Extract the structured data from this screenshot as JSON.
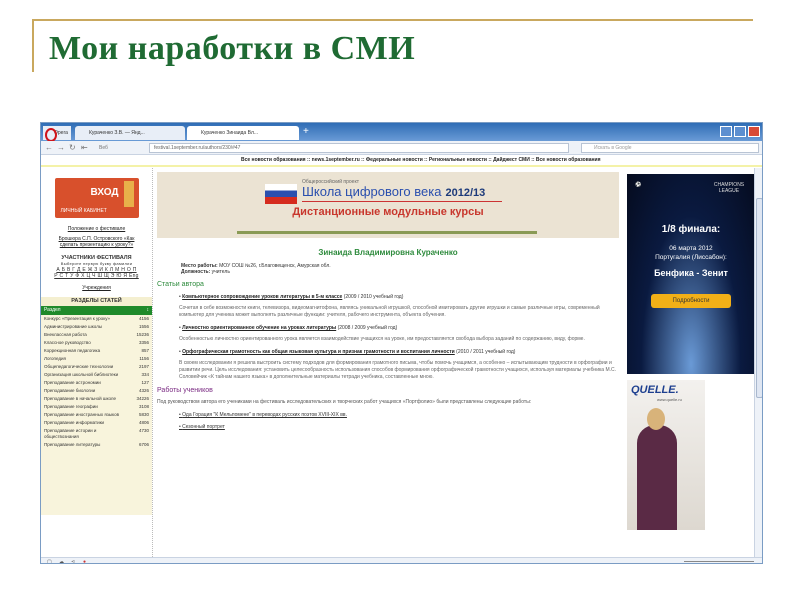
{
  "slide": {
    "title": "Мои наработки в СМИ"
  },
  "browser": {
    "tabs": [
      {
        "label": "Opera"
      },
      {
        "label": "Кураченко З.В. — Янд..."
      },
      {
        "label": "Кураченко Зинаида Вл..."
      }
    ],
    "url": "festival.1september.ru/authors/230/#47",
    "speed_dial_label": "Веб",
    "search_placeholder": "Искать в Google",
    "news_bar": "Все новости образования :: news.1september.ru :: Федеральные новости :: Региональные новости :: Дайджест СМИ :: Все новости образования"
  },
  "sidebar": {
    "login": {
      "title": "ВХОД",
      "subtitle": "ЛИЧНЫЙ КАБИНЕТ"
    },
    "links": [
      "Положение о фестивале",
      "Брошюра С.П. Островского «Как сделать презентацию к уроку?»"
    ],
    "participants_heading": "УЧАСТНИКИ ФЕСТИВАЛЯ",
    "participants_hint": "Выберите первую букву фамилии",
    "alphabet1": "А Б В Г Д Е Ж З И К Л М Н О П",
    "alphabet2": "Р С Т У Ф Х Ц Ч Ш Щ Э Ю Я Eng",
    "institutions": "Учреждения",
    "sections_heading": "РАЗДЕЛЫ СТАТЕЙ",
    "select_value": "Раздел",
    "categories": [
      {
        "name": "Конкурс «Презентация к уроку»",
        "count": "4156"
      },
      {
        "name": "Администрирование школы",
        "count": "1556"
      },
      {
        "name": "Внеклассная работа",
        "count": "15236"
      },
      {
        "name": "Классное руководство",
        "count": "3356"
      },
      {
        "name": "Коррекционная педагогика",
        "count": "857"
      },
      {
        "name": "Логопедия",
        "count": "1156"
      },
      {
        "name": "Общепедагогические технологии",
        "count": "2197"
      },
      {
        "name": "Организация школьной библиотеки",
        "count": "334"
      },
      {
        "name": "Преподавание астрономии",
        "count": "127"
      },
      {
        "name": "Преподавание биологии",
        "count": "4326"
      },
      {
        "name": "Преподавание в начальной школе",
        "count": "34226"
      },
      {
        "name": "Преподавание географии",
        "count": "3108"
      },
      {
        "name": "Преподавание иностранных языков",
        "count": "5830"
      },
      {
        "name": "Преподавание информатики",
        "count": "4806"
      },
      {
        "name": "Преподавание истории и обществознания",
        "count": "4730"
      },
      {
        "name": "Преподавание литературы",
        "count": "6706"
      }
    ]
  },
  "main": {
    "banner": {
      "project": "Общероссийский проект",
      "school": "Школа цифрового века",
      "year": "2012/13",
      "courses": "Дистанционные модульные курсы"
    },
    "author": "Зинаида Владимировна Кураченко",
    "workplace_label": "Место работы:",
    "workplace": "МОУ СОШ №26, г.Благовещенск, Амурская обл.",
    "position_label": "Должность:",
    "position": "учитель",
    "articles_heading": "Статьи автора",
    "articles": [
      {
        "title": "Компьютерное сопровождение уроков литературы в 5-м классе",
        "year": "(2009 / 2010 учебный год)",
        "desc": "Сочетая в себе возможности книги, телевизора, видеомагнитофона, являясь уникальной игрушкой, способной имитировать другие игрушки и самые различные игры, современный компьютер для ученика может выполнять различные функции: учителя, рабочего инструмента, объекта обучения."
      },
      {
        "title": "Личностно ориентированное обучение на уроках литературы",
        "year": "(2008 / 2009 учебный год)",
        "desc": "Особенностью личностно ориентированного урока является взаимодействие учащихся на уроке, им предоставляется свобода выбора заданий по содержанию, виду, форме."
      },
      {
        "title": "Орфографическая грамотность как общая языковая культура и признак грамотности и воспитания личности",
        "year": "(2010 / 2011 учебный год)",
        "desc": "В своем исследовании я решила выстроить систему подходов для формирования грамотного письма, чтобы помочь учащимся, а особенно – испытывающим трудности в орфографии и развитии речи. Цель исследования: установить целесообразность использования способов формирования орфографической грамотности учащихся, используя материалы учебника М.С. Соловейчик «К тайнам нашего языка» в дополнительные материалы тетради учебника, составленные мною."
      }
    ],
    "students_heading": "Работы учеников",
    "students_text": "Под руководством автора его учениками на фестиваль исследовательских и творческих работ учащихся «Портфолио» были представлены следующие работы:",
    "student_works": [
      "Ода Горация \"К Мельпомене\" в переводах русских поэтов XVIII-XIX вв.",
      "Сезонный портрет"
    ]
  },
  "ads": {
    "ucl": {
      "brand": "CHAMPIONS LEAGUE",
      "round": "1/8 финала:",
      "date": "06 марта 2012",
      "place": "Португалия (Лиссабон):",
      "match": "Бенфика - Зенит",
      "button": "Подробности"
    },
    "quelle": {
      "brand": "QUELLE.",
      "site": "www.quelle.ru"
    }
  }
}
